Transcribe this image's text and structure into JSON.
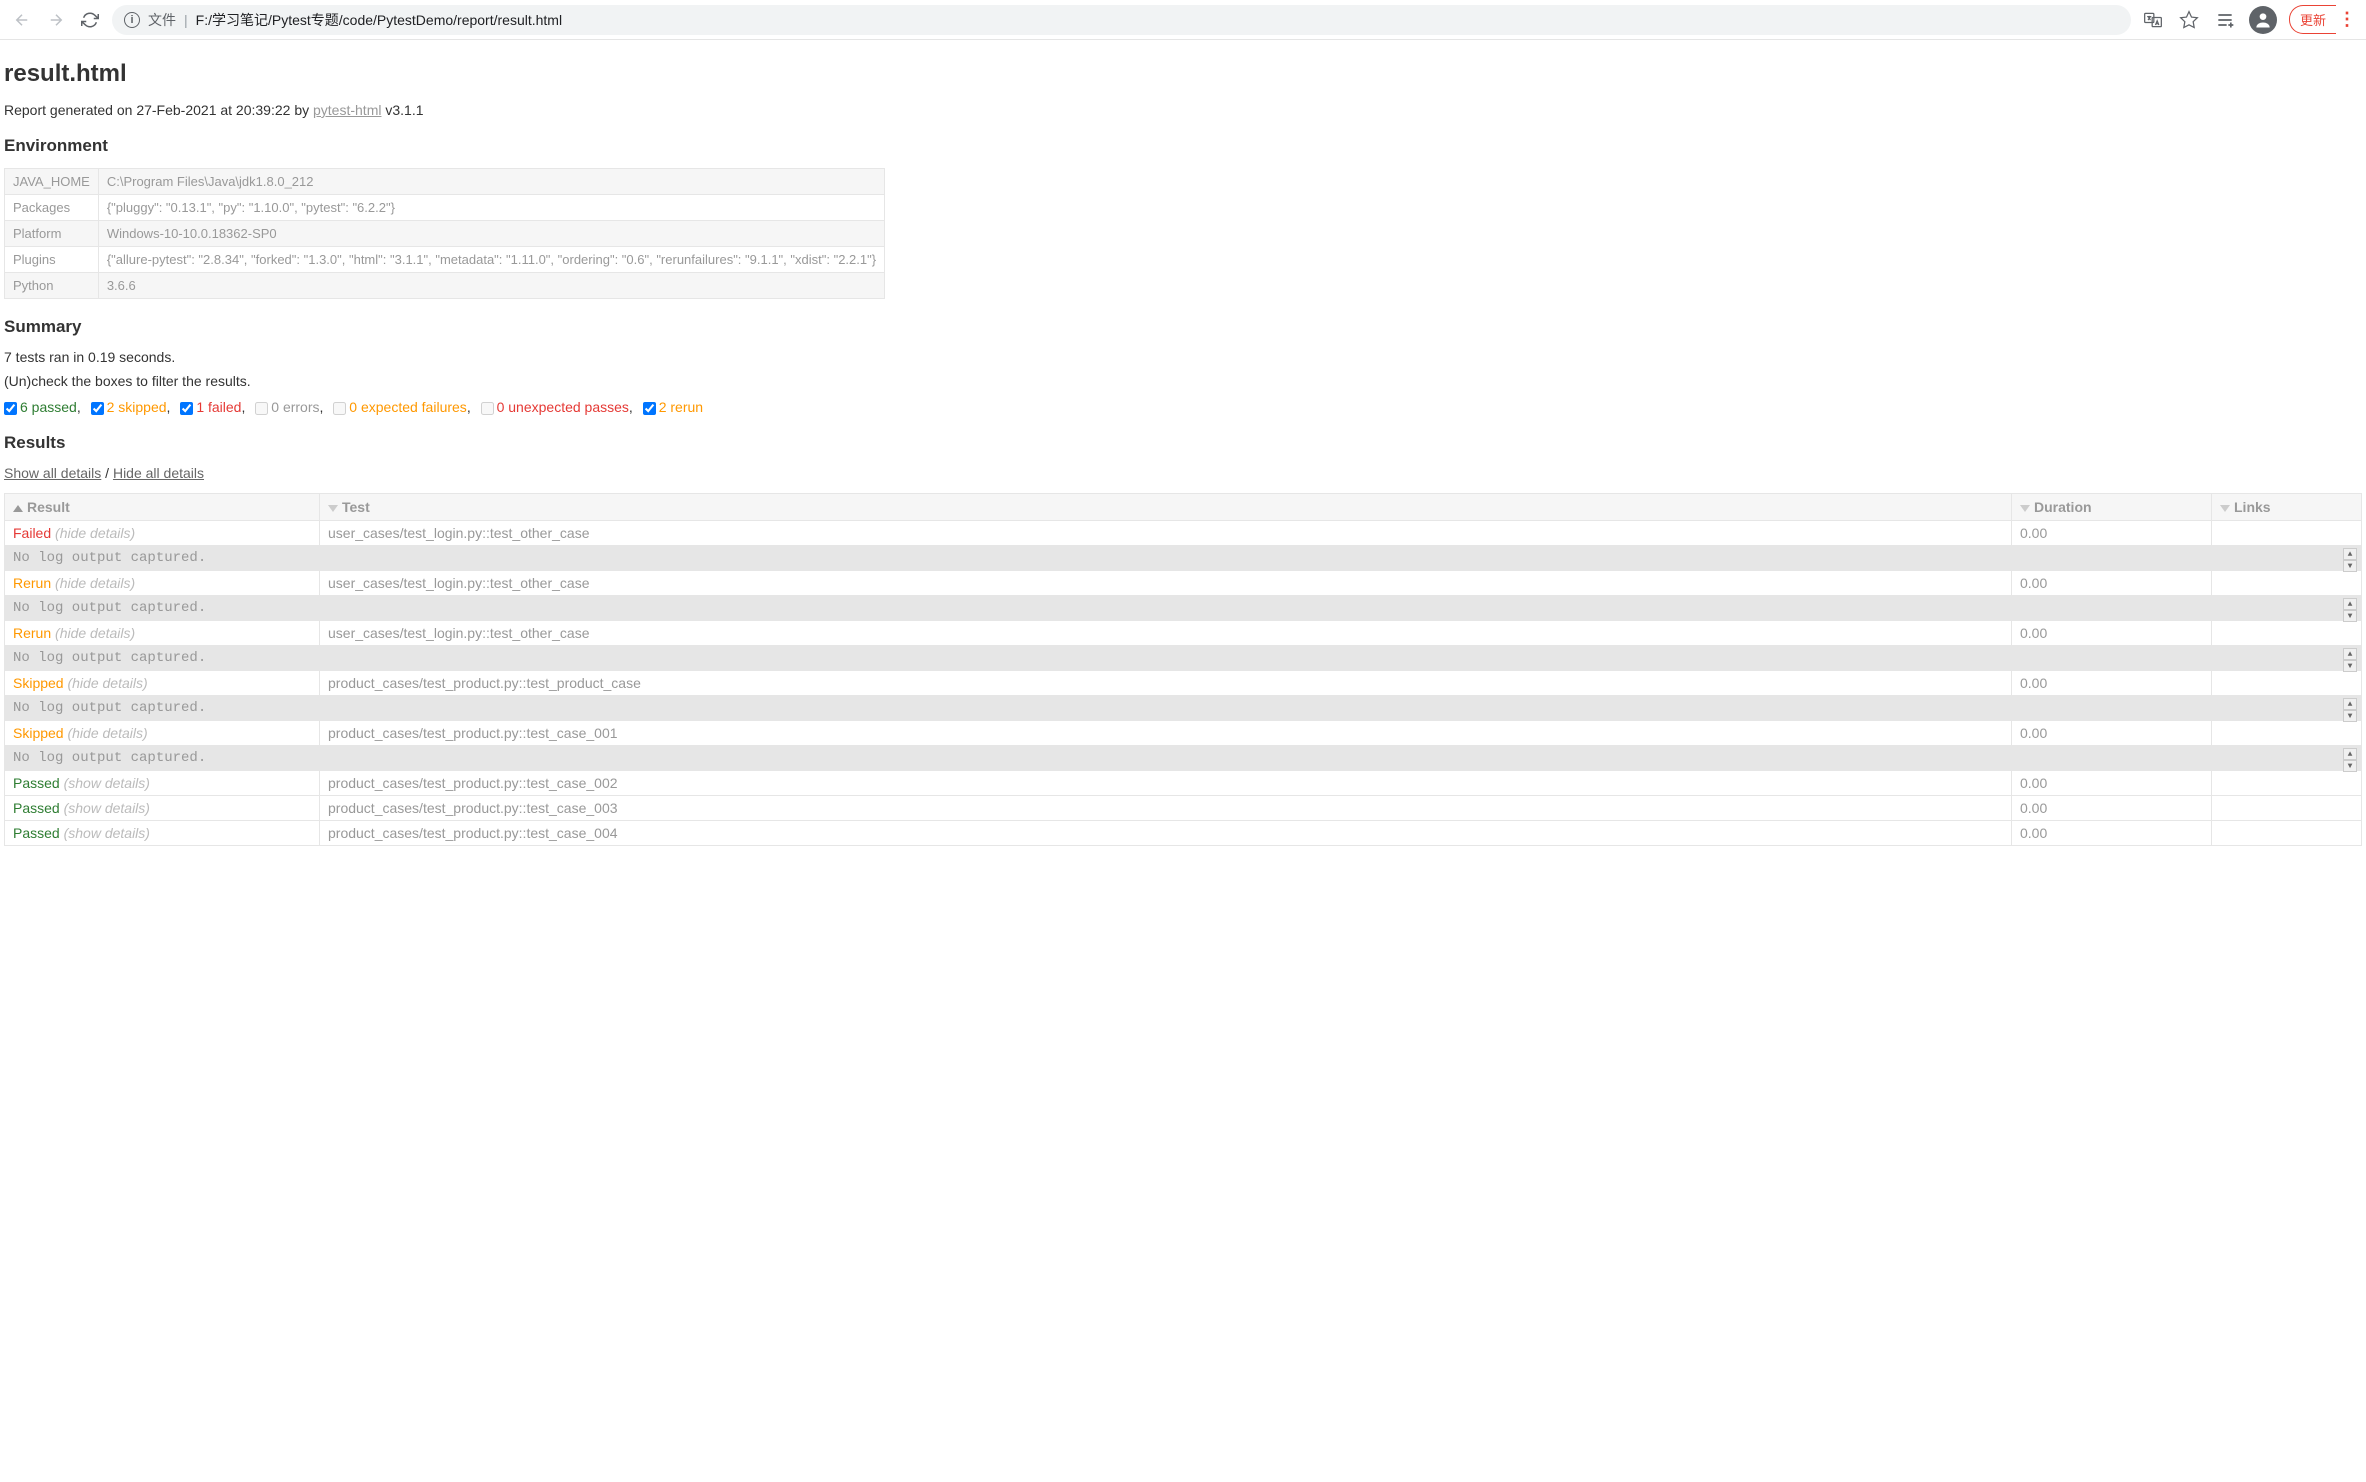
{
  "browser": {
    "address_prefix": "文件",
    "address_path": "F:/学习笔记/Pytest专题/code/PytestDemo/report/result.html",
    "update_btn": "更新"
  },
  "page_title": "result.html",
  "generated_line_prefix": "Report generated on 27-Feb-2021 at 20:39:22 by ",
  "generated_link": "pytest-html",
  "generated_version": " v3.1.1",
  "env_heading": "Environment",
  "env_rows": [
    {
      "k": "JAVA_HOME",
      "v": "C:\\Program Files\\Java\\jdk1.8.0_212"
    },
    {
      "k": "Packages",
      "v": "{\"pluggy\": \"0.13.1\", \"py\": \"1.10.0\", \"pytest\": \"6.2.2\"}"
    },
    {
      "k": "Platform",
      "v": "Windows-10-10.0.18362-SP0"
    },
    {
      "k": "Plugins",
      "v": "{\"allure-pytest\": \"2.8.34\", \"forked\": \"1.3.0\", \"html\": \"3.1.1\", \"metadata\": \"1.11.0\", \"ordering\": \"0.6\", \"rerunfailures\": \"9.1.1\", \"xdist\": \"2.2.1\"}"
    },
    {
      "k": "Python",
      "v": "3.6.6"
    }
  ],
  "summary_heading": "Summary",
  "summary_line": "7 tests ran in 0.19 seconds.",
  "filter_help": "(Un)check the boxes to filter the results.",
  "filters": {
    "passed": "6 passed",
    "skipped": "2 skipped",
    "failed": "1 failed",
    "errors": "0 errors",
    "xfailed": "0 expected failures",
    "xpassed": "0 unexpected passes",
    "rerun": "2 rerun"
  },
  "results_heading": "Results",
  "show_all": "Show all details",
  "hide_all": "Hide all details",
  "columns": {
    "result": "Result",
    "test": "Test",
    "duration": "Duration",
    "links": "Links"
  },
  "details_hide": "(hide details)",
  "details_show": "(show details)",
  "no_log": "No log output captured.",
  "rows": [
    {
      "result": "Failed",
      "cls": "failed",
      "expanded": true,
      "test": "user_cases/test_login.py::test_other_case",
      "duration": "0.00"
    },
    {
      "result": "Rerun",
      "cls": "rerun",
      "expanded": true,
      "test": "user_cases/test_login.py::test_other_case",
      "duration": "0.00"
    },
    {
      "result": "Rerun",
      "cls": "rerun",
      "expanded": true,
      "test": "user_cases/test_login.py::test_other_case",
      "duration": "0.00"
    },
    {
      "result": "Skipped",
      "cls": "skipped",
      "expanded": true,
      "test": "product_cases/test_product.py::test_product_case",
      "duration": "0.00"
    },
    {
      "result": "Skipped",
      "cls": "skipped",
      "expanded": true,
      "test": "product_cases/test_product.py::test_case_001",
      "duration": "0.00"
    },
    {
      "result": "Passed",
      "cls": "passed",
      "expanded": false,
      "test": "product_cases/test_product.py::test_case_002",
      "duration": "0.00"
    },
    {
      "result": "Passed",
      "cls": "passed",
      "expanded": false,
      "test": "product_cases/test_product.py::test_case_003",
      "duration": "0.00"
    },
    {
      "result": "Passed",
      "cls": "passed",
      "expanded": false,
      "test": "product_cases/test_product.py::test_case_004",
      "duration": "0.00"
    }
  ]
}
